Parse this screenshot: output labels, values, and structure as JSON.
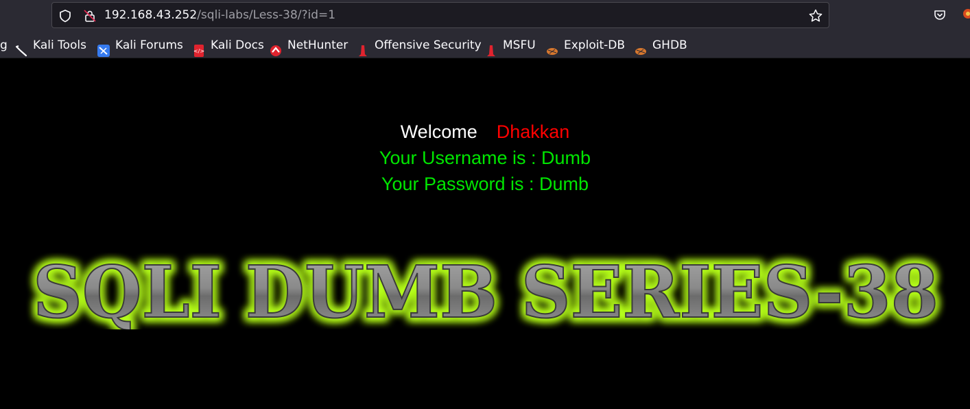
{
  "browser": {
    "url_host": "192.168.43.252",
    "url_path": "/sqli-labs/Less-38/?id=1"
  },
  "bookmarks": [
    {
      "label": "g",
      "icon": "kali-icon"
    },
    {
      "label": "Kali Tools",
      "icon": "kali-tools-icon"
    },
    {
      "label": "Kali Forums",
      "icon": "kali-forums-icon"
    },
    {
      "label": "Kali Docs",
      "icon": "kali-docs-icon"
    },
    {
      "label": "NetHunter",
      "icon": "nethunter-icon"
    },
    {
      "label": "Offensive Security",
      "icon": "offsec-icon"
    },
    {
      "label": "MSFU",
      "icon": "msfu-icon"
    },
    {
      "label": "Exploit-DB",
      "icon": "exploit-db-icon"
    },
    {
      "label": "GHDB",
      "icon": "ghdb-icon"
    }
  ],
  "page": {
    "welcome_label": "Welcome",
    "welcome_name": "Dhakkan",
    "username_line": "Your Username is : Dumb",
    "password_line": "Your Password is : Dumb",
    "banner_text": "SQLI DUMB SERIES-38"
  },
  "colors": {
    "background": "#000000",
    "welcome_name": "#ff0000",
    "result_text": "#00e600",
    "banner_glow": "#b6ff1a"
  }
}
